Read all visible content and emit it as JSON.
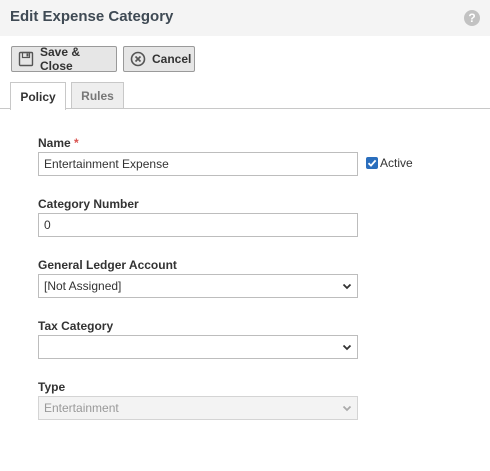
{
  "window": {
    "title": "Edit Expense Category",
    "help_icon": "?"
  },
  "toolbar": {
    "save_label": "Save & Close",
    "cancel_label": "Cancel"
  },
  "tabs": [
    {
      "label": "Policy",
      "active": true
    },
    {
      "label": "Rules",
      "active": false
    }
  ],
  "form": {
    "name": {
      "label": "Name",
      "required_marker": "*",
      "value": "Entertainment Expense"
    },
    "active": {
      "label": "Active",
      "checked": true
    },
    "category_number": {
      "label": "Category Number",
      "value": "0"
    },
    "gl_account": {
      "label": "General Ledger Account",
      "value": "[Not Assigned]"
    },
    "tax_category": {
      "label": "Tax Category",
      "value": ""
    },
    "type": {
      "label": "Type",
      "value": "Entertainment",
      "disabled": true
    }
  },
  "colors": {
    "accent": "#2a6ebd",
    "required": "#d9534f",
    "titlebar_bg": "#f4f4f4"
  }
}
